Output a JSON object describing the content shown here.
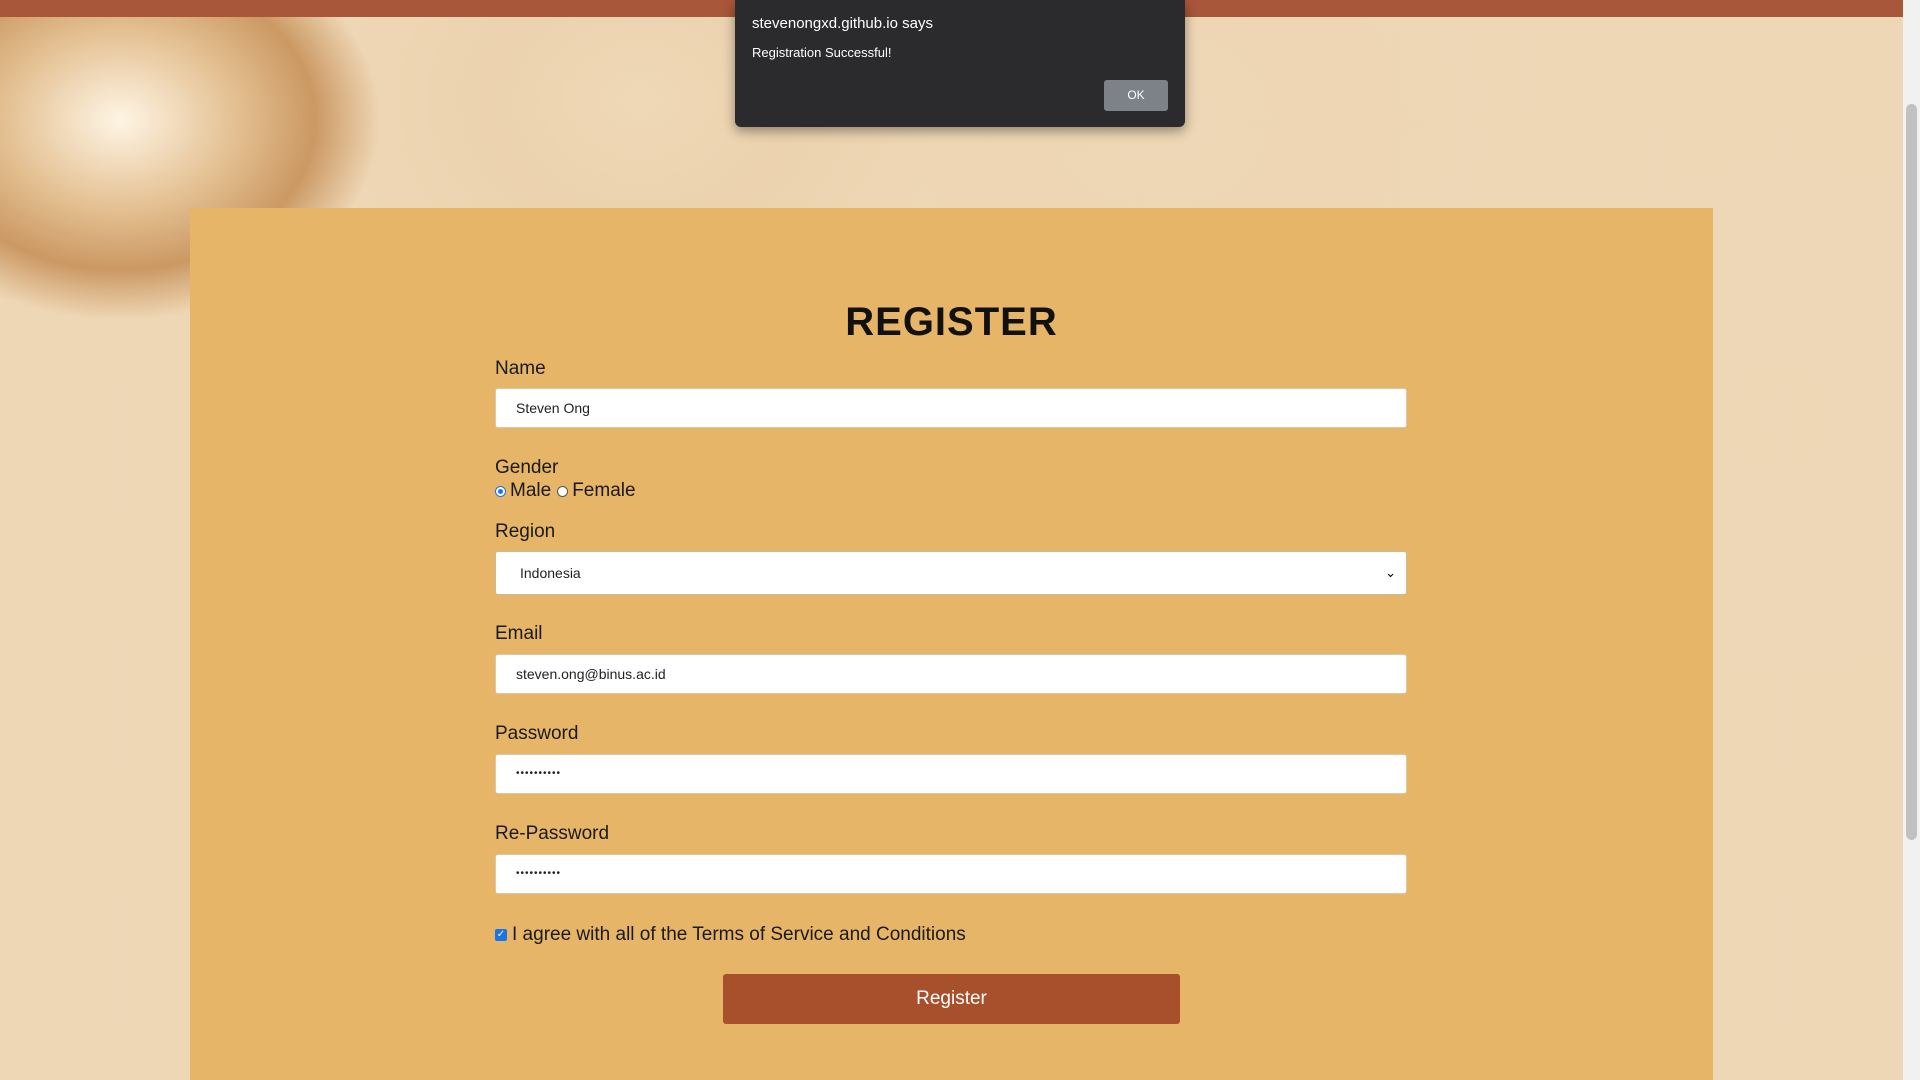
{
  "dialog": {
    "title": "stevenongxd.github.io says",
    "message": "Registration Successful!",
    "ok_label": "OK"
  },
  "form": {
    "title": "REGISTER",
    "name_label": "Name",
    "name_value": "Steven Ong",
    "gender_label": "Gender",
    "gender_options": [
      "Male",
      "Female"
    ],
    "gender_selected": "Male",
    "region_label": "Region",
    "region_value": "Indonesia",
    "email_label": "Email",
    "email_value": "steven.ong@binus.ac.id",
    "password_label": "Password",
    "password_value": "••••••••••",
    "repassword_label": "Re-Password",
    "repassword_value": "••••••••••",
    "terms_label": "I agree with all of the Terms of Service and Conditions",
    "terms_checked": true,
    "submit_label": "Register"
  },
  "colors": {
    "topbar": "#a8573a",
    "panel": "#e7b568",
    "button": "#a8502c",
    "dialog": "#2b2b2d"
  }
}
